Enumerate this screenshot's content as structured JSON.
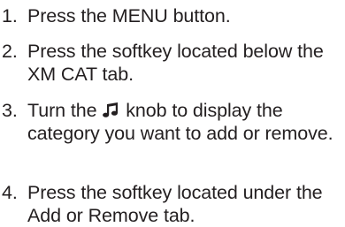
{
  "steps": [
    {
      "number": "1.",
      "text": "Press the MENU button."
    },
    {
      "number": "2.",
      "text": "Press the softkey located below the XM CAT tab."
    },
    {
      "number": "3.",
      "text_before_icon": "Turn the",
      "icon": "music-note-icon",
      "text_after_icon": "knob to display the category you want to add or remove."
    },
    {
      "number": "4.",
      "text": "Press the softkey located under the Add or Remove tab."
    }
  ]
}
